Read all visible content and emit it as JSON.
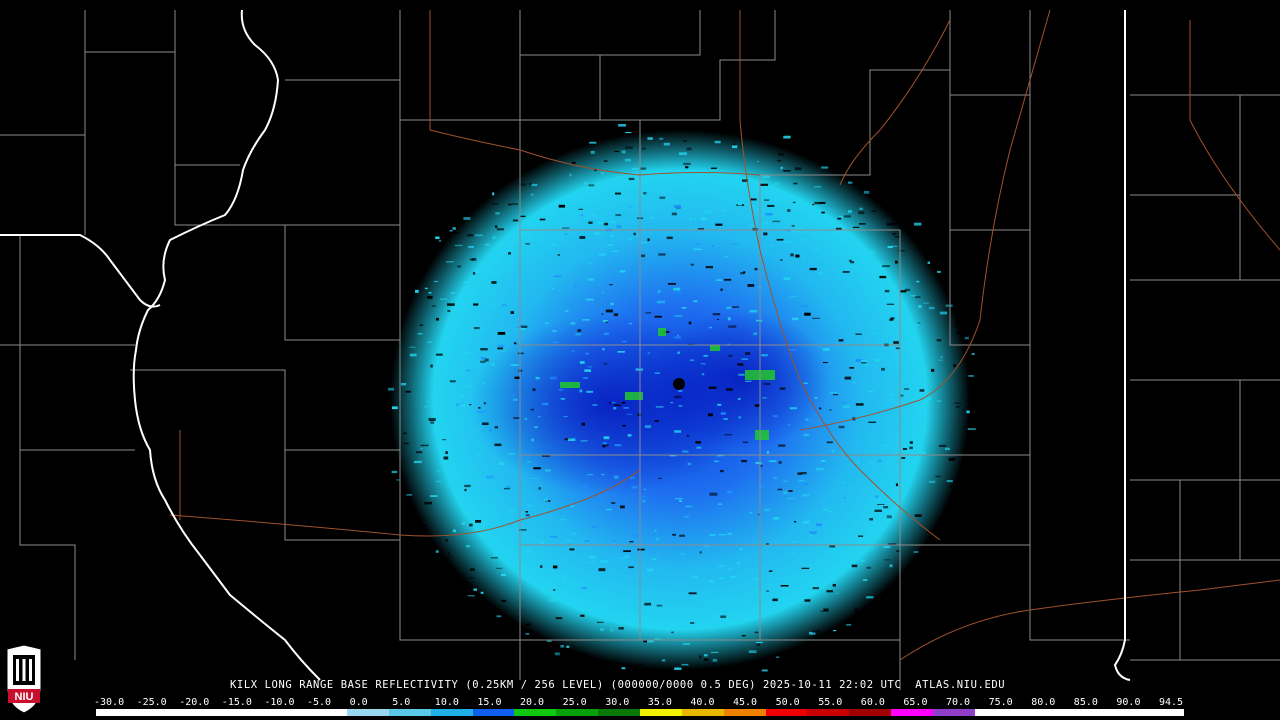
{
  "caption": "KILX LONG RANGE BASE REFLECTIVITY (0.25KM / 256 LEVEL) (000000/0000 0.5 DEG) 2025-10-11 22:02 UTC  ATLAS.NIU.EDU",
  "logo_text": "NIU",
  "scale": {
    "labels": [
      "-30.0",
      "-25.0",
      "-20.0",
      "-15.0",
      "-10.0",
      "-5.0",
      "0.0",
      "5.0",
      "10.0",
      "15.0",
      "20.0",
      "25.0",
      "30.0",
      "35.0",
      "40.0",
      "45.0",
      "50.0",
      "55.0",
      "60.0",
      "65.0",
      "70.0",
      "75.0",
      "80.0",
      "85.0",
      "90.0",
      "94.5"
    ],
    "colors": [
      "#ffffff",
      "#ffffff",
      "#ffffff",
      "#ffffff",
      "#ffffff",
      "#ffffff",
      "#9ad8f0",
      "#5cc8e8",
      "#20b0e8",
      "#1060f0",
      "#10c810",
      "#08a008",
      "#087808",
      "#f0f000",
      "#e8b800",
      "#f08000",
      "#f00000",
      "#c80000",
      "#a00000",
      "#ff00ff",
      "#9040c8",
      "#ffffff",
      "#ffffff",
      "#ffffff",
      "#ffffff",
      "#ffffff"
    ]
  },
  "map_colors": {
    "background": "#000000",
    "county_lines": "#8c8c8c",
    "state_lines": "#ffffff",
    "highways": "#a0522d",
    "echo_light": "#22d4f0",
    "echo_mid": "#1e90ff",
    "echo_dark": "#0a3ad8",
    "echo_green": "#22c82a",
    "radar_site": "#000000"
  },
  "radar_site": "KILX"
}
